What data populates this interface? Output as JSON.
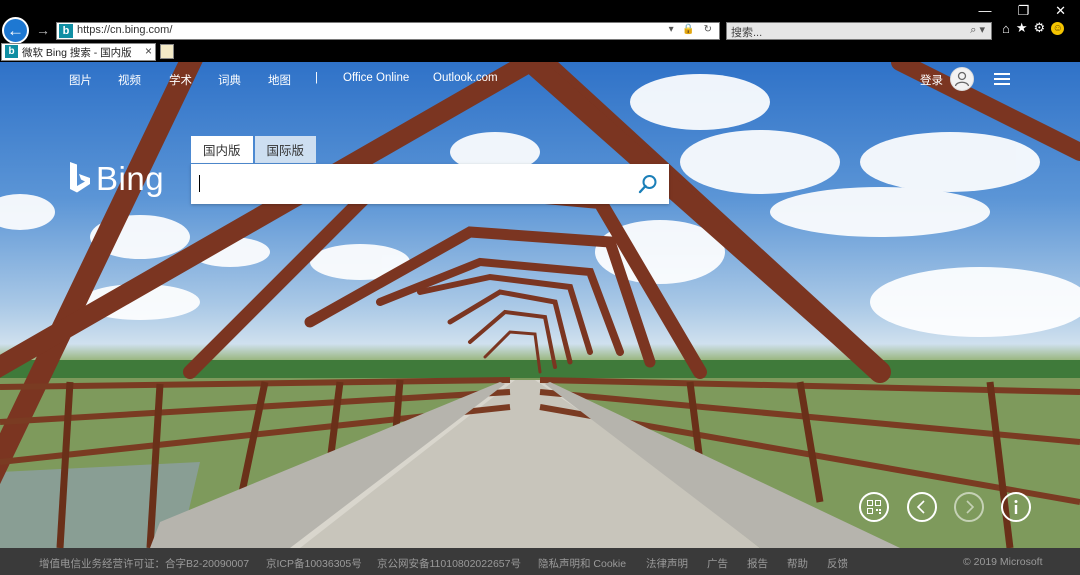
{
  "browser": {
    "url": "https://cn.bing.com/",
    "search_placeholder": "搜索...",
    "tab_title": "微软 Bing 搜索 - 国内版",
    "favicon_letter": "b",
    "window_controls": [
      "—",
      "❐",
      "✕"
    ],
    "address_controls": "▾ 🔒 ↻",
    "search_icon": "⌕ ▾",
    "tool_icons": [
      "home-icon",
      "star-icon",
      "gear-icon",
      "smiley-icon"
    ]
  },
  "nav": {
    "items": [
      {
        "label": "图片"
      },
      {
        "label": "视频"
      },
      {
        "label": "学术"
      },
      {
        "label": "词典"
      },
      {
        "label": "地图"
      },
      {
        "label": "|"
      },
      {
        "label": "Office Online"
      },
      {
        "label": "Outlook.com"
      }
    ],
    "signin": "登录"
  },
  "logo": {
    "word": "Bing"
  },
  "search": {
    "tabs": [
      {
        "label": "国内版",
        "active": true
      },
      {
        "label": "国际版",
        "active": false
      }
    ],
    "value": ""
  },
  "controls": [
    "qr-code-icon",
    "previous-image-icon",
    "next-image-icon",
    "info-icon"
  ],
  "footer": {
    "items": [
      {
        "label": "增值电信业务经营许可证：合字B2-20090007"
      },
      {
        "label": "京ICP备10036305号"
      },
      {
        "label": "京公网安备11010802022657号"
      },
      {
        "label": "隐私声明和 Cookie"
      },
      {
        "label": "法律声明"
      },
      {
        "label": "广告"
      },
      {
        "label": "报告"
      },
      {
        "label": "帮助"
      },
      {
        "label": "反馈"
      },
      {
        "label": "© 2019 Microsoft"
      }
    ]
  },
  "colors": {
    "chrome_bg": "#000000",
    "back_button": "#1e78d2",
    "favicon": "#0f8ea3",
    "bridge_rust": "#7b3521",
    "footer_bg": "#3a3a3a",
    "footer_text": "#9a9a9a"
  }
}
